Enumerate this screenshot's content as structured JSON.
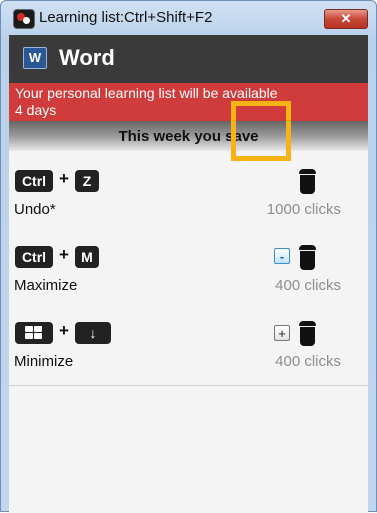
{
  "window": {
    "title": "Learning list:Ctrl+Shift+F2",
    "close_glyph": "✕"
  },
  "app": {
    "icon_label": "W",
    "name": "Word"
  },
  "banner": {
    "line1": "Your personal learning list will be available",
    "line2": "4 days"
  },
  "save_bar": {
    "text": "This week you save"
  },
  "shortcuts": [
    {
      "key1": "Ctrl",
      "plus": "+",
      "key2": "Z",
      "label": "Undo*",
      "clicks": "1000 clicks"
    },
    {
      "key1": "Ctrl",
      "plus": "+",
      "key2": "M",
      "label": "Maximize",
      "clicks": "400 clicks",
      "toggle": "-"
    },
    {
      "key1_icon": "windows-logo-icon",
      "plus": "+",
      "key2": "↓",
      "label": "Minimize",
      "clicks": "400 clicks",
      "toggle": "+"
    }
  ],
  "colors": {
    "banner": "#d03b3b",
    "header": "#3a3a3a",
    "highlight": "#f7b214"
  }
}
